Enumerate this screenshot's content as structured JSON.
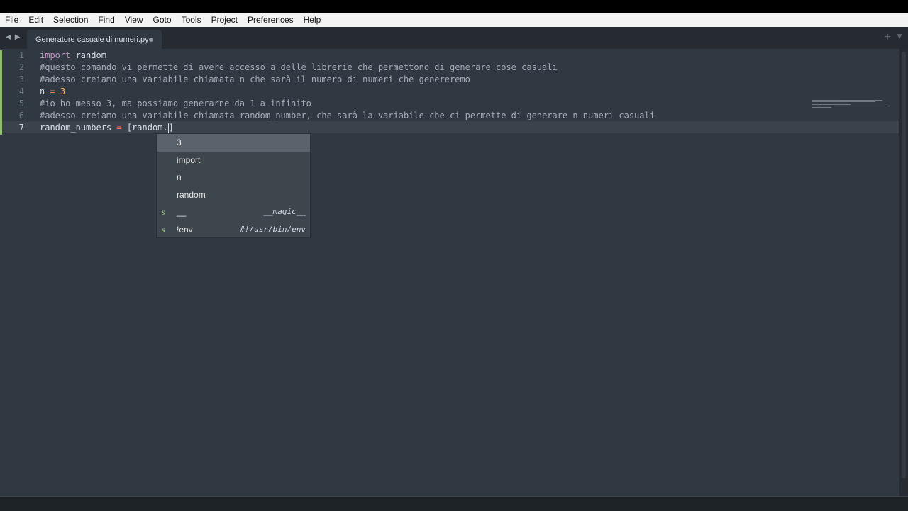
{
  "menu": [
    "File",
    "Edit",
    "Selection",
    "Find",
    "View",
    "Goto",
    "Tools",
    "Project",
    "Preferences",
    "Help"
  ],
  "tab": {
    "title": "Generatore casuale di numeri.py"
  },
  "lines": [
    {
      "num": "1",
      "code": "import random"
    },
    {
      "num": "2",
      "code": "#questo comando vi permette di avere accesso a delle librerie che permettono di generare cose casuali"
    },
    {
      "num": "3",
      "code": "#adesso creiamo una variabile chiamata n che sarà il numero di numeri che genereremo"
    },
    {
      "num": "4",
      "code": "n = 3"
    },
    {
      "num": "5",
      "code": "#io ho messo 3, ma possiamo generarne da 1 a infinito"
    },
    {
      "num": "6",
      "code": "#adesso creiamo una variabile chiamata random_number, che sarà la variabile che ci permette di generare n numeri casuali"
    },
    {
      "num": "7",
      "code": "random_numbers = [random.]"
    }
  ],
  "autocomplete": [
    {
      "label": "3",
      "kind": "",
      "hint": ""
    },
    {
      "label": "import",
      "kind": "",
      "hint": ""
    },
    {
      "label": "n",
      "kind": "",
      "hint": ""
    },
    {
      "label": "random",
      "kind": "",
      "hint": ""
    },
    {
      "label": "__",
      "kind": "s",
      "hint": "__magic__"
    },
    {
      "label": "!env",
      "kind": "s",
      "hint": "#!/usr/bin/env"
    }
  ],
  "colors": {
    "background": "#303841",
    "accent_green": "#8fbf6f"
  }
}
